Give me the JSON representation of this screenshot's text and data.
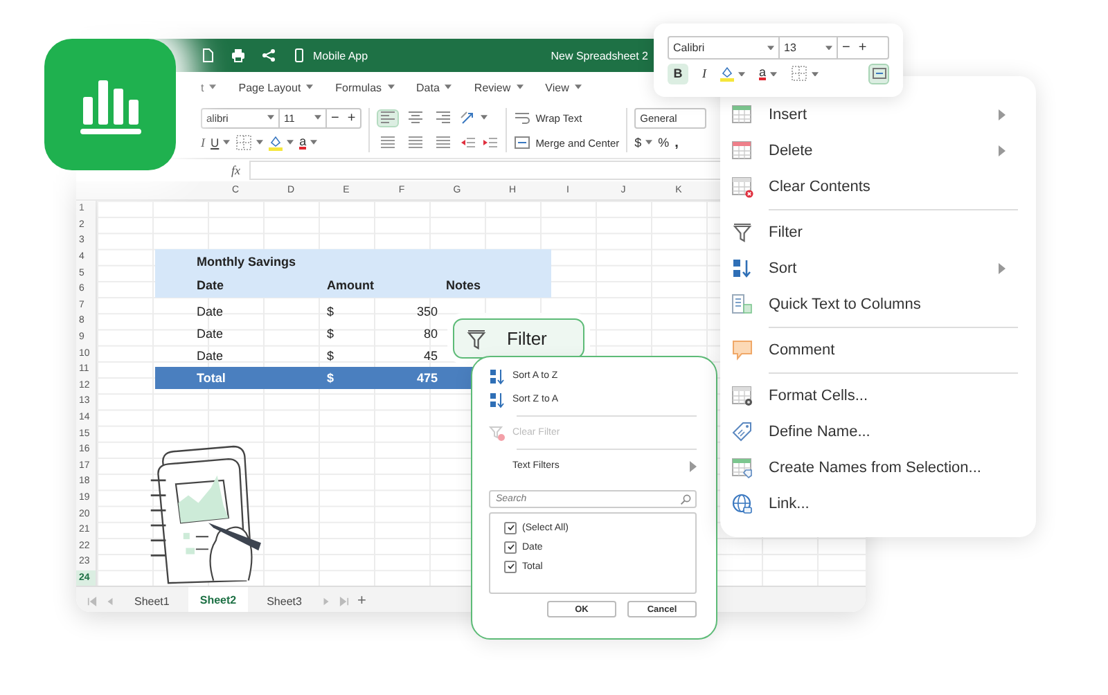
{
  "title_bar": {
    "mobile_label": "Mobile App",
    "document_title": "New Spreadsheet 2"
  },
  "menu": [
    "t",
    "Page Layout",
    "Formulas",
    "Data",
    "Review",
    "View"
  ],
  "ribbon": {
    "font": "alibri",
    "size": "11",
    "minus": "−",
    "plus": "+",
    "italic": "I",
    "underline": "U",
    "font_color": "a",
    "wrap_text": "Wrap Text",
    "merge": "Merge and Center",
    "number_format": "General",
    "currency": "$",
    "percent": "%",
    "comma": ",",
    "align_buttons": [
      {
        "selected": true
      },
      {
        "selected": false
      },
      {
        "selected": false
      }
    ]
  },
  "formula_bar": {
    "fx": "fx"
  },
  "columns": [
    "C",
    "D",
    "E",
    "F",
    "G",
    "H",
    "I",
    "J",
    "K"
  ],
  "rows": [
    {
      "label": "1",
      "selected": false
    },
    {
      "label": "2",
      "selected": false
    },
    {
      "label": "3",
      "selected": false
    },
    {
      "label": "4",
      "selected": false
    },
    {
      "label": "5",
      "selected": false
    },
    {
      "label": "6",
      "selected": false
    },
    {
      "label": "7",
      "selected": false
    },
    {
      "label": "8",
      "selected": false
    },
    {
      "label": "9",
      "selected": false
    },
    {
      "label": "10",
      "selected": false
    },
    {
      "label": "11",
      "selected": false
    },
    {
      "label": "12",
      "selected": false
    },
    {
      "label": "13",
      "selected": false
    },
    {
      "label": "14",
      "selected": false
    },
    {
      "label": "15",
      "selected": false
    },
    {
      "label": "16",
      "selected": false
    },
    {
      "label": "17",
      "selected": false
    },
    {
      "label": "18",
      "selected": false
    },
    {
      "label": "19",
      "selected": false
    },
    {
      "label": "20",
      "selected": false
    },
    {
      "label": "21",
      "selected": false
    },
    {
      "label": "22",
      "selected": false
    },
    {
      "label": "23",
      "selected": false
    },
    {
      "label": "24",
      "selected": true
    }
  ],
  "table": {
    "title": "Monthly Savings",
    "headers": [
      "Date",
      "Amount",
      "Notes"
    ],
    "rows": [
      [
        "Date",
        "$",
        "350"
      ],
      [
        "Date",
        "$",
        "80"
      ],
      [
        "Date",
        "$",
        "45"
      ]
    ],
    "total": [
      "Total",
      "$",
      "475"
    ]
  },
  "sheet_tabs": [
    {
      "label": "Sheet1",
      "selected": false
    },
    {
      "label": "Sheet2",
      "selected": true
    },
    {
      "label": "Sheet3",
      "selected": false
    }
  ],
  "add_sheet": "+",
  "filter_button": {
    "label": "Filter"
  },
  "filter_menu": {
    "groups": [
      [
        {
          "label": "Sort A to Z",
          "kind": "sort-asc",
          "disabled": false
        },
        {
          "label": "Sort Z to A",
          "kind": "sort-desc",
          "disabled": false
        }
      ],
      [
        {
          "label": "Clear Filter",
          "kind": "clear",
          "disabled": true
        }
      ],
      [
        {
          "label": "Text Filters",
          "kind": "submenu",
          "disabled": false
        }
      ]
    ],
    "search_placeholder": "Search",
    "values": [
      {
        "label": "(Select All)",
        "checked": true
      },
      {
        "label": "Date",
        "checked": true
      },
      {
        "label": "Total",
        "checked": true
      }
    ],
    "ok": "OK",
    "cancel": "Cancel"
  },
  "context_menu": [
    [
      {
        "label": "Insert",
        "kind": "insert",
        "submenu": true
      },
      {
        "label": "Delete",
        "kind": "delete",
        "submenu": true
      },
      {
        "label": "Clear Contents",
        "kind": "clear",
        "submenu": false
      }
    ],
    [
      {
        "label": "Filter",
        "kind": "filter",
        "submenu": false
      },
      {
        "label": "Sort",
        "kind": "sort",
        "submenu": true
      },
      {
        "label": "Quick Text to Columns",
        "kind": "text-to-columns",
        "submenu": false
      }
    ],
    [
      {
        "label": "Comment",
        "kind": "comment",
        "submenu": false
      }
    ],
    [
      {
        "label": "Format Cells...",
        "kind": "format",
        "submenu": false
      },
      {
        "label": "Define Name...",
        "kind": "define-name",
        "submenu": false
      },
      {
        "label": "Create Names from Selection...",
        "kind": "create-names",
        "submenu": false
      },
      {
        "label": "Link...",
        "kind": "link",
        "submenu": false
      }
    ]
  ],
  "mini_toolbar": {
    "font": "Calibri",
    "size": "13",
    "minus": "−",
    "plus": "+",
    "bold": {
      "label": "B",
      "selected": true
    },
    "italic": "I",
    "font_color": "a",
    "merge_selected": true
  }
}
